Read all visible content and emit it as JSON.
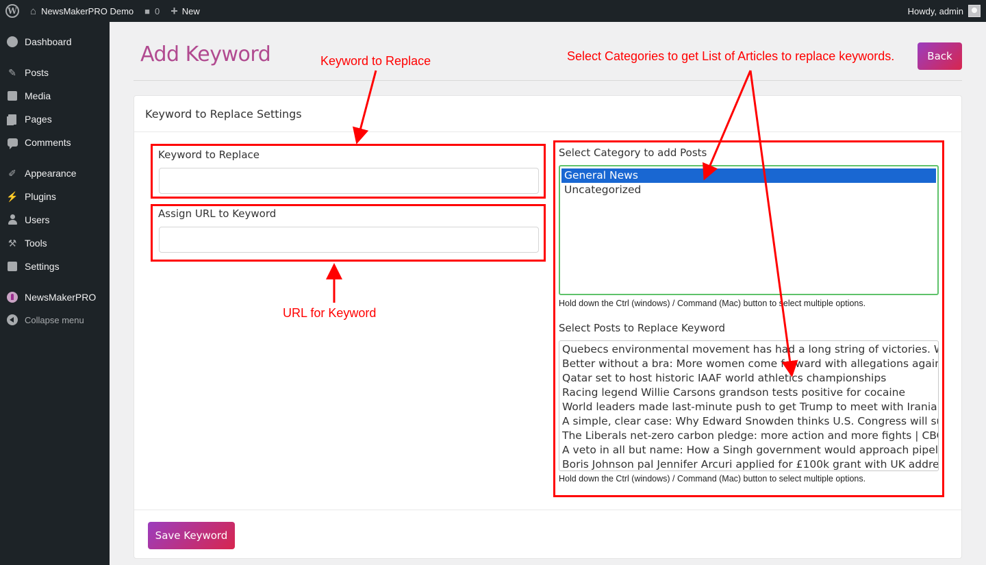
{
  "adminbar": {
    "site_name": "NewsMakerPRO Demo",
    "comments_count": "0",
    "new_label": "New",
    "howdy": "Howdy, admin"
  },
  "sidebar": {
    "items": [
      {
        "label": "Dashboard",
        "icon": "dashboard-icon"
      },
      {
        "label": "Posts",
        "icon": "pin-icon"
      },
      {
        "label": "Media",
        "icon": "media-icon"
      },
      {
        "label": "Pages",
        "icon": "pages-icon"
      },
      {
        "label": "Comments",
        "icon": "comments-icon"
      },
      {
        "label": "Appearance",
        "icon": "brush-icon"
      },
      {
        "label": "Plugins",
        "icon": "plug-icon"
      },
      {
        "label": "Users",
        "icon": "user-icon"
      },
      {
        "label": "Tools",
        "icon": "wrench-icon"
      },
      {
        "label": "Settings",
        "icon": "settings-icon"
      },
      {
        "label": "NewsMakerPRO",
        "icon": "rocket-icon"
      },
      {
        "label": "Collapse menu",
        "icon": "collapse-icon"
      }
    ]
  },
  "page": {
    "title": "Add Keyword",
    "back_label": "Back"
  },
  "card": {
    "header": "Keyword to Replace Settings",
    "keyword_label": "Keyword to Replace",
    "url_label": "Assign URL to Keyword",
    "category_label": "Select Category to add Posts",
    "category_options": [
      "General News",
      "Uncategorized"
    ],
    "category_selected": "General News",
    "category_help": "Hold down the Ctrl (windows) / Command (Mac) button to select multiple options.",
    "posts_label": "Select Posts to Replace Keyword",
    "posts_options": [
      "Quebecs environmental movement has had a long string of victories. What",
      "Better without a bra: More women come forward with allegations against C",
      "Qatar set to host historic IAAF world athletics championships",
      "Racing legend Willie Carsons grandson tests positive for cocaine",
      "World leaders made last-minute push to get Trump to meet with Iranian pr",
      "A simple, clear case: Why Edward Snowden thinks U.S. Congress will suppor",
      "The Liberals net-zero carbon pledge: more action and more fights | CBC Ne",
      "A veto in all but name: How a Singh government would approach pipelines",
      "Boris Johnson pal Jennifer Arcuri applied for £100k grant with UK address"
    ],
    "posts_help": "Hold down the Ctrl (windows) / Command (Mac) button to select multiple options.",
    "save_label": "Save Keyword"
  },
  "annotations": {
    "keyword": "Keyword to Replace",
    "url": "URL for Keyword",
    "categories": "Select Categories to get List of Articles to replace keywords.",
    "color": "#ff0000"
  }
}
